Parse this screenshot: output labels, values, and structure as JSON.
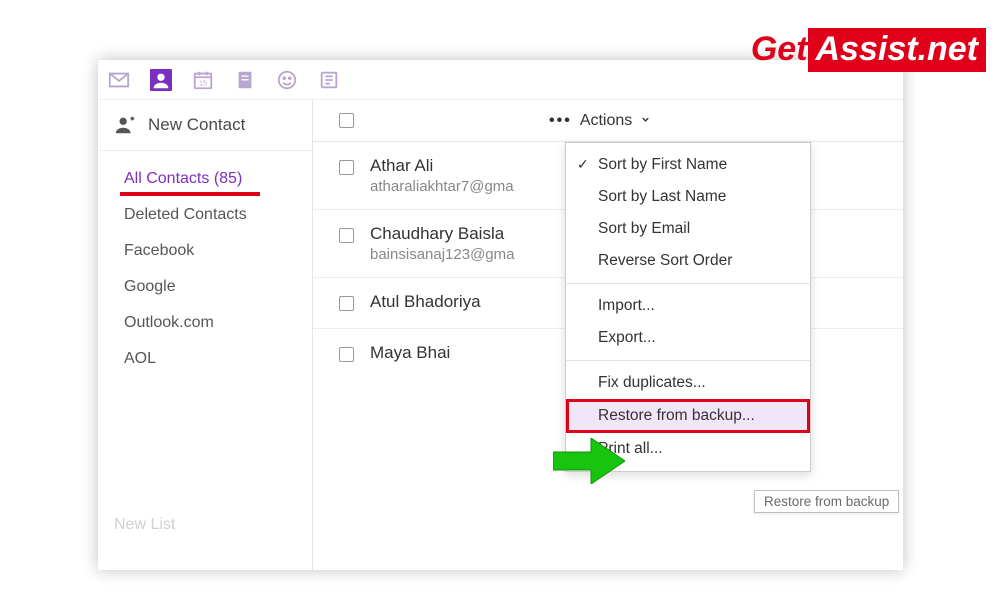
{
  "watermark": {
    "part1": "Get",
    "part2": "Assist.net"
  },
  "topbar": {
    "icons": [
      "mail-icon",
      "contact-icon",
      "calendar-icon",
      "notepad-icon",
      "messenger-icon",
      "news-icon"
    ]
  },
  "sidebar": {
    "new_contact_label": "New Contact",
    "items": [
      {
        "label": "All Contacts (85)",
        "active": true
      },
      {
        "label": "Deleted Contacts",
        "active": false
      },
      {
        "label": "Facebook",
        "active": false
      },
      {
        "label": "Google",
        "active": false
      },
      {
        "label": "Outlook.com",
        "active": false
      },
      {
        "label": "AOL",
        "active": false
      }
    ],
    "new_list_label": "New List"
  },
  "content": {
    "actions_label": "Actions",
    "contacts": [
      {
        "name": "Athar Ali",
        "email": "atharaliakhtar7@gma"
      },
      {
        "name": "Chaudhary Baisla",
        "email": "bainsisanaj123@gma"
      },
      {
        "name": "Atul Bhadoriya",
        "email": ""
      },
      {
        "name": "Maya Bhai",
        "email": ""
      }
    ]
  },
  "actions_menu": {
    "group1": [
      {
        "label": "Sort by First Name",
        "checked": true
      },
      {
        "label": "Sort by Last Name",
        "checked": false
      },
      {
        "label": "Sort by Email",
        "checked": false
      },
      {
        "label": "Reverse Sort Order",
        "checked": false
      }
    ],
    "group2": [
      {
        "label": "Import..."
      },
      {
        "label": "Export..."
      }
    ],
    "group3": [
      {
        "label": "Fix duplicates...",
        "highlight": false
      },
      {
        "label": "Restore from backup...",
        "highlight": true
      },
      {
        "label": "Print all...",
        "highlight": false
      }
    ]
  },
  "tooltip": "Restore from backup",
  "colors": {
    "accent": "#7b2fbf",
    "red": "#e1001a",
    "green": "#17c40e"
  }
}
